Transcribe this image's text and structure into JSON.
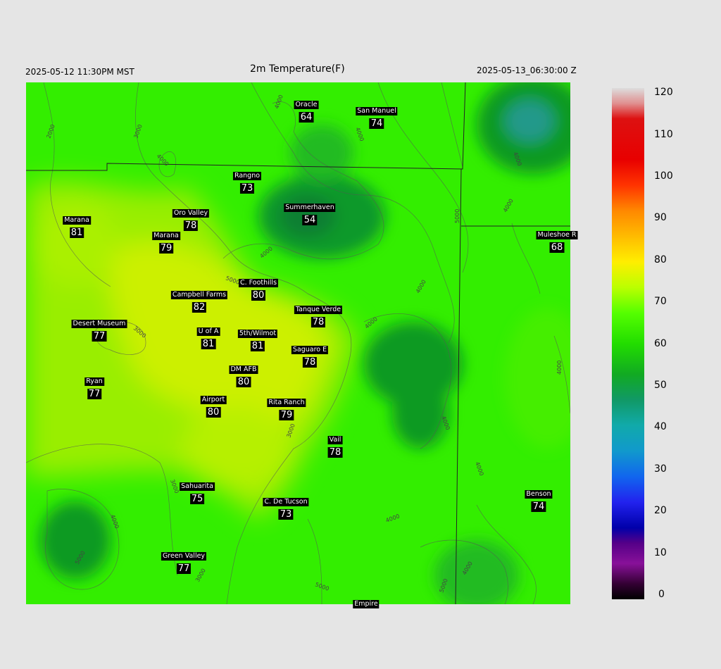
{
  "header": {
    "local_time": "2025-05-12 11:30PM MST",
    "title": "2m Temperature(F)",
    "valid_time": "2025-05-13_06:30:00 Z"
  },
  "stations": [
    {
      "name": "Oracle",
      "temp": "64"
    },
    {
      "name": "San Manuel",
      "temp": "74"
    },
    {
      "name": "Rangno",
      "temp": "73"
    },
    {
      "name": "Summerhaven",
      "temp": "54"
    },
    {
      "name": "Marana",
      "temp": "81"
    },
    {
      "name": "Oro Valley",
      "temp": "78"
    },
    {
      "name": "Marana",
      "temp": "79"
    },
    {
      "name": "Muleshoe R",
      "temp": "68"
    },
    {
      "name": "C. Foothills",
      "temp": "80"
    },
    {
      "name": "Campbell Farms",
      "temp": "82"
    },
    {
      "name": "Tanque Verde",
      "temp": "78"
    },
    {
      "name": "Desert Museum",
      "temp": "77"
    },
    {
      "name": "U of A",
      "temp": "81"
    },
    {
      "name": "5th/Wilmot",
      "temp": "81"
    },
    {
      "name": "Saguaro E",
      "temp": "78"
    },
    {
      "name": "DM AFB",
      "temp": "80"
    },
    {
      "name": "Ryan",
      "temp": "77"
    },
    {
      "name": "Airport",
      "temp": "80"
    },
    {
      "name": "Rita Ranch",
      "temp": "79"
    },
    {
      "name": "Vail",
      "temp": "78"
    },
    {
      "name": "Sahuarita",
      "temp": "75"
    },
    {
      "name": "C. De Tucson",
      "temp": "73"
    },
    {
      "name": "Benson",
      "temp": "74"
    },
    {
      "name": "Green Valley",
      "temp": "77"
    },
    {
      "name": "Empire",
      "temp": ""
    }
  ],
  "contour_labels": [
    "2000",
    "3000",
    "4000",
    "5000"
  ],
  "colorbar": {
    "labels": [
      "120",
      "110",
      "100",
      "90",
      "80",
      "70",
      "60",
      "50",
      "40",
      "30",
      "20",
      "10",
      "0"
    ],
    "min": 0,
    "max": 122,
    "colors": {
      "warm_core": "#ccf000",
      "lowland": "#99ee00",
      "mid": "#33ee00",
      "mountain": "#119a22",
      "peak_teal": "#22998a"
    }
  }
}
